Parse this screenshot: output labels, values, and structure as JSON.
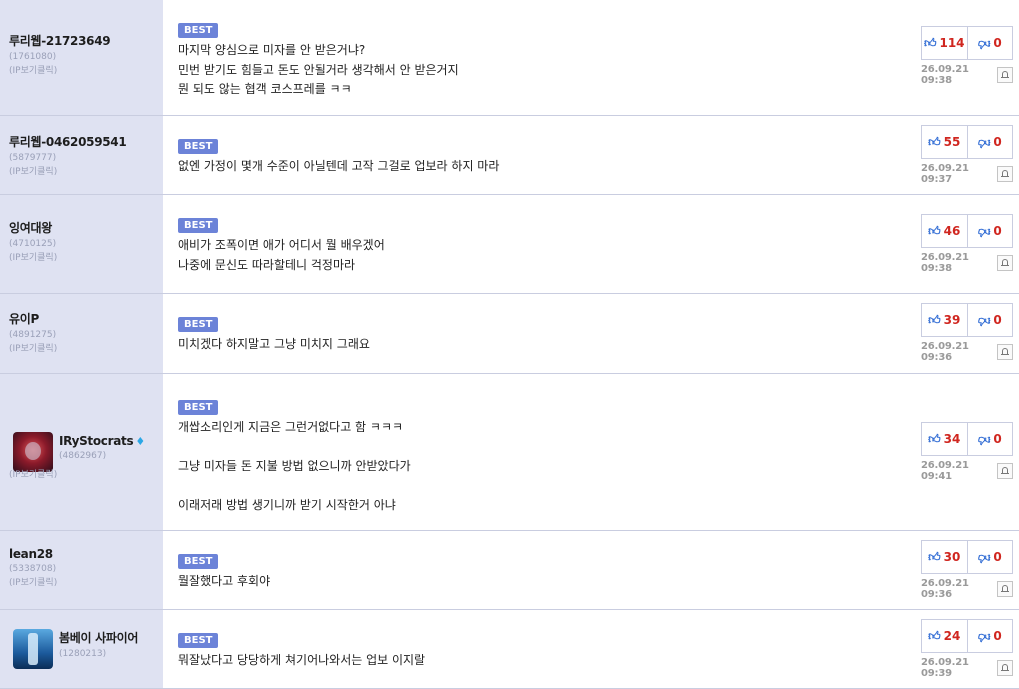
{
  "comments": [
    {
      "name": "루리웹-21723649",
      "id": "(1761080)",
      "ip": "(IP보기클릭)",
      "badge": "BEST",
      "lines": [
        "마지막 양심으로 미자를 안 받은거냐?",
        "민번 받기도 힘들고 돈도 안될거라 생각해서 안 받은거지",
        "뭔 되도 않는 협객 코스프레를 ㅋㅋ"
      ],
      "up": "114",
      "down": "0",
      "date": "26.09.21 09:38"
    },
    {
      "name": "루리웹-0462059541",
      "id": "(5879777)",
      "ip": "(IP보기클릭)",
      "badge": "BEST",
      "lines": [
        "없엔 가정이 몇개 수준이 아닐텐데 고작 그걸로 업보라 하지 마라"
      ],
      "up": "55",
      "down": "0",
      "date": "26.09.21 09:37"
    },
    {
      "name": "잉여대왕",
      "id": "(4710125)",
      "ip": "(IP보기클릭)",
      "badge": "BEST",
      "lines": [
        "애비가 조폭이면 애가 어디서 뭘 배우겠어",
        "나중에 문신도 따라할테니 걱정마라"
      ],
      "up": "46",
      "down": "0",
      "date": "26.09.21 09:38"
    },
    {
      "name": "유이P",
      "id": "(4891275)",
      "ip": "(IP보기클릭)",
      "badge": "BEST",
      "lines": [
        "미치겠다 하지말고 그냥 미치지 그래요"
      ],
      "up": "39",
      "down": "0",
      "date": "26.09.21 09:36"
    },
    {
      "name": "IRyStocrats",
      "id": "(4862967)",
      "ip": "(IP보기클릭)",
      "badge": "BEST",
      "lines": [
        "개쌉소리인게 지금은 그런거없다고 함 ㅋㅋㅋ",
        "",
        "그냥 미자들 돈 지불 방법 없으니까 안받았다가",
        "",
        "이래저래 방법 생기니까 받기 시작한거 아냐"
      ],
      "up": "34",
      "down": "0",
      "date": "26.09.21 09:41"
    },
    {
      "name": "lean28",
      "id": "(5338708)",
      "ip": "(IP보기클릭)",
      "badge": "BEST",
      "lines": [
        "뭘잘했다고 후회야"
      ],
      "up": "30",
      "down": "0",
      "date": "26.09.21 09:36"
    },
    {
      "name": "봄베이 사파이어",
      "id": "(1280213)",
      "ip": "(IP보기클릭)",
      "badge": "BEST",
      "lines": [
        "뭐잘났다고 당당하게 쳐기어나와서는 업보 이지랄"
      ],
      "up": "24",
      "down": "0",
      "date": "26.09.21 09:39"
    }
  ],
  "icons": {
    "upvote": "thumbs-up-icon",
    "downvote": "thumbs-down-icon",
    "report": "bell-icon",
    "badge": "diamond-icon"
  },
  "colors": {
    "user_bg": "#dfe2f2",
    "best_badge": "#6c83d8",
    "vote_count": "#d0261f",
    "thumb": "#2f6bd4"
  }
}
